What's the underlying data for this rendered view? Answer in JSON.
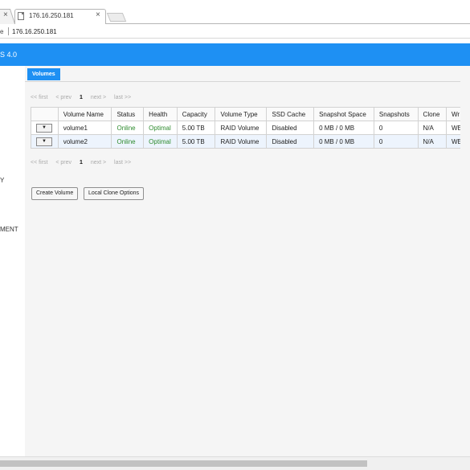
{
  "browser": {
    "prev_tab_close": "×",
    "tab_title": "176.16.250.181",
    "tab_close": "×",
    "address_prefix": "e",
    "url": "176.16.250.181"
  },
  "app": {
    "title": "S 4.0"
  },
  "sidebar": {
    "items": [
      {
        "label": "Y"
      },
      {
        "label": "MENT"
      }
    ]
  },
  "content": {
    "tab_label": "Volumes",
    "pager": {
      "first": "<< first",
      "prev": "< prev",
      "page": "1",
      "next": "next >",
      "last": "last >>"
    },
    "table": {
      "columns": [
        "",
        "Volume Name",
        "Status",
        "Health",
        "Capacity",
        "Volume Type",
        "SSD Cache",
        "Snapshot Space",
        "Snapshots",
        "Clone",
        "Wr"
      ],
      "rows": [
        {
          "menu": "▼",
          "name": "volume1",
          "status": "Online",
          "health": "Optimal",
          "capacity": "5.00 TB",
          "type": "RAID Volume",
          "ssd_cache": "Disabled",
          "snapshot_space": "0 MB / 0 MB",
          "snapshots": "0",
          "clone": "N/A",
          "wr": "WE"
        },
        {
          "menu": "▼",
          "name": "volume2",
          "status": "Online",
          "health": "Optimal",
          "capacity": "5.00 TB",
          "type": "RAID Volume",
          "ssd_cache": "Disabled",
          "snapshot_space": "0 MB / 0 MB",
          "snapshots": "0",
          "clone": "N/A",
          "wr": "WE"
        }
      ]
    },
    "buttons": {
      "create_volume": "Create Volume",
      "local_clone_options": "Local Clone Options"
    }
  },
  "colors": {
    "accent": "#1e90f3",
    "status_ok": "#2e8b2e",
    "row_alt": "#edf4fd"
  }
}
